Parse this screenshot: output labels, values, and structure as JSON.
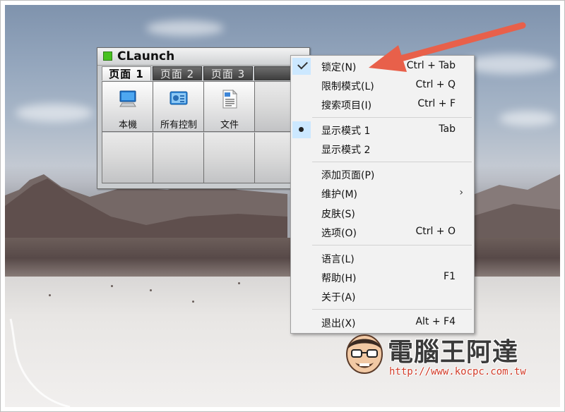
{
  "claunch": {
    "title": "CLaunch",
    "tabs": [
      {
        "label": "页面 1",
        "active": true
      },
      {
        "label": "页面 2",
        "active": false
      },
      {
        "label": "页面 3",
        "active": false
      }
    ],
    "items": [
      {
        "label": "本機",
        "icon": "computer-icon"
      },
      {
        "label": "所有控制",
        "icon": "control-panel-icon"
      },
      {
        "label": "文件",
        "icon": "document-icon"
      }
    ]
  },
  "menu": {
    "items": [
      {
        "label": "锁定(N)",
        "shortcut": "Ctrl + Tab",
        "state": "checked"
      },
      {
        "label": "限制模式(L)",
        "shortcut": "Ctrl + Q",
        "state": ""
      },
      {
        "label": "搜索项目(I)",
        "shortcut": "Ctrl + F",
        "state": ""
      },
      {
        "label": "显示模式 1",
        "shortcut": "Tab",
        "state": "radio"
      },
      {
        "label": "显示模式 2",
        "shortcut": "",
        "state": ""
      },
      {
        "label": "添加页面(P)",
        "shortcut": "",
        "state": ""
      },
      {
        "label": "维护(M)",
        "shortcut": "",
        "state": "submenu"
      },
      {
        "label": "皮肤(S)",
        "shortcut": "",
        "state": ""
      },
      {
        "label": "选项(O)",
        "shortcut": "Ctrl + O",
        "state": ""
      },
      {
        "label": "语言(L)",
        "shortcut": "",
        "state": ""
      },
      {
        "label": "帮助(H)",
        "shortcut": "F1",
        "state": ""
      },
      {
        "label": "关于(A)",
        "shortcut": "",
        "state": ""
      },
      {
        "label": "退出(X)",
        "shortcut": "Alt + F4",
        "state": ""
      }
    ]
  },
  "watermark": {
    "title": "電腦王阿達",
    "url": "http://www.kocpc.com.tw"
  },
  "colors": {
    "accent_arrow": "#e8604a",
    "menu_selection": "#cce8ff",
    "claunch_logo": "#47c11f",
    "watermark_url": "#d13b28"
  }
}
